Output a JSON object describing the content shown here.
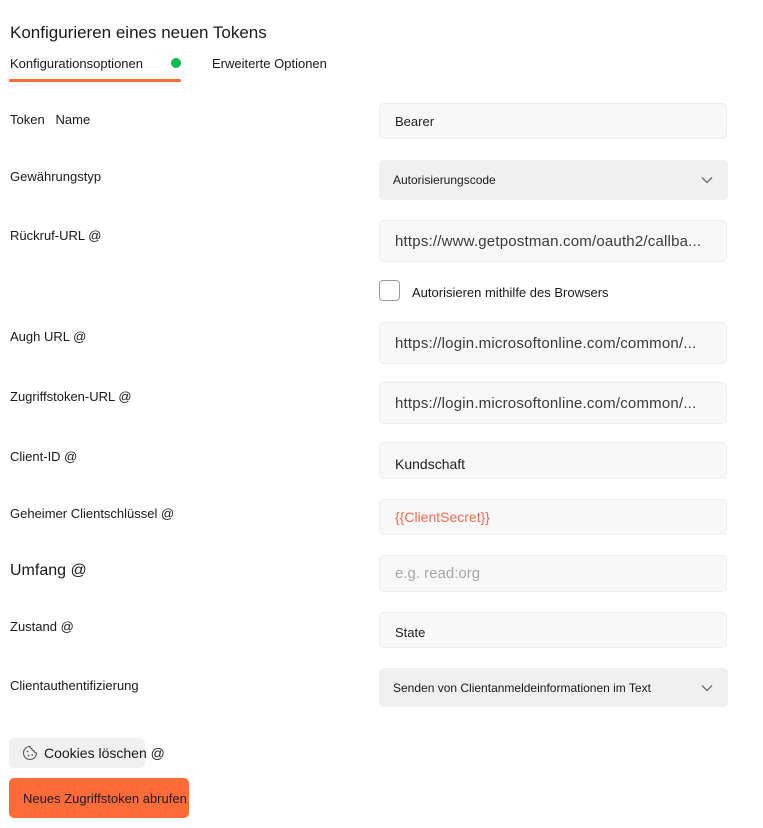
{
  "header": {
    "title": "Konfigurieren eines neuen Tokens"
  },
  "tabs": [
    {
      "label": "Konfigurationsoptionen",
      "active": true,
      "status_dot_color": "#0cbb52"
    },
    {
      "label": "Erweiterte Optionen",
      "active": false
    }
  ],
  "accent_color": "#ff6c37",
  "form": {
    "token_name": {
      "label_part1": "Token",
      "label_part2": "Name",
      "value": "Bearer"
    },
    "grant_type": {
      "label": "Gewährungstyp",
      "value": "Autorisierungscode",
      "icon": "chevron-down-icon"
    },
    "callback_url": {
      "label": "Rückruf-URL @",
      "value": "https://www.getpostman.com/oauth2/callba..."
    },
    "authorize_browser": {
      "label": "Autorisieren mithilfe des Browsers",
      "checked": false
    },
    "auth_url": {
      "label": "Augh URL @",
      "value": "https://login.microsoftonline.com/common/..."
    },
    "access_token_url": {
      "label": "Zugriffstoken-URL @",
      "value": "https://login.microsoftonline.com/common/..."
    },
    "client_id": {
      "label": "Client-ID @",
      "value": "Kundschaft"
    },
    "client_secret": {
      "label": "Geheimer Clientschlüssel @",
      "value": "{{ClientSecret}}"
    },
    "scope": {
      "label": "Umfang @",
      "value": "",
      "placeholder": "e.g. read:org"
    },
    "state": {
      "label": "Zustand @",
      "value": "State"
    },
    "client_auth": {
      "label": "Clientauthentifizierung",
      "value": "Senden von Clientanmeldeinformationen im Text",
      "icon": "chevron-down-icon"
    }
  },
  "buttons": {
    "clear_cookies": {
      "label": "Cookies löschen @",
      "icon": "cookie-icon"
    },
    "get_token": {
      "label": "Neues Zugriffstoken abrufen"
    }
  }
}
